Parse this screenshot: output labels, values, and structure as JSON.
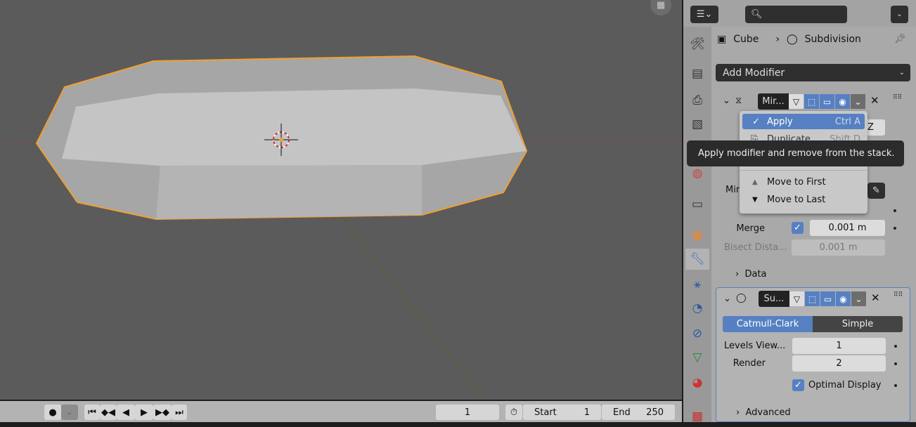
{
  "timeline": {
    "current_frame": "1",
    "start_label": "Start",
    "start": "1",
    "end_label": "End",
    "end": "250"
  },
  "properties": {
    "breadcrumb": {
      "object": "Cube",
      "modifier": "Subdivision"
    },
    "add_modifier": "Add Modifier",
    "mirror": {
      "name": "Mir...",
      "mirror_object_label": "Mir",
      "merge_label": "Merge",
      "merge_value": "0.001 m",
      "merge_checked": true,
      "bisect_label": "Bisect Dista...",
      "bisect_value": "0.001 m",
      "data_label": "Data",
      "axis_z": "Z"
    },
    "subdivision": {
      "name": "Su...",
      "mode_options": [
        "Catmull-Clark",
        "Simple"
      ],
      "mode_selected": "Catmull-Clark",
      "levels_label": "Levels View...",
      "levels_value": "1",
      "render_label": "Render",
      "render_value": "2",
      "optimal_label": "Optimal Display",
      "optimal_checked": true,
      "advanced_label": "Advanced"
    }
  },
  "menu": {
    "items": [
      {
        "label": "Apply",
        "shortcut": "Ctrl A"
      },
      {
        "label": "Duplicate",
        "shortcut": "Shift D"
      },
      {
        "label": "Move to First"
      },
      {
        "label": "Move to Last"
      }
    ]
  },
  "tooltip": "Apply modifier and remove from the stack.",
  "colors": {
    "accent": "#5680c2",
    "selection_outline": "#f0a030"
  }
}
